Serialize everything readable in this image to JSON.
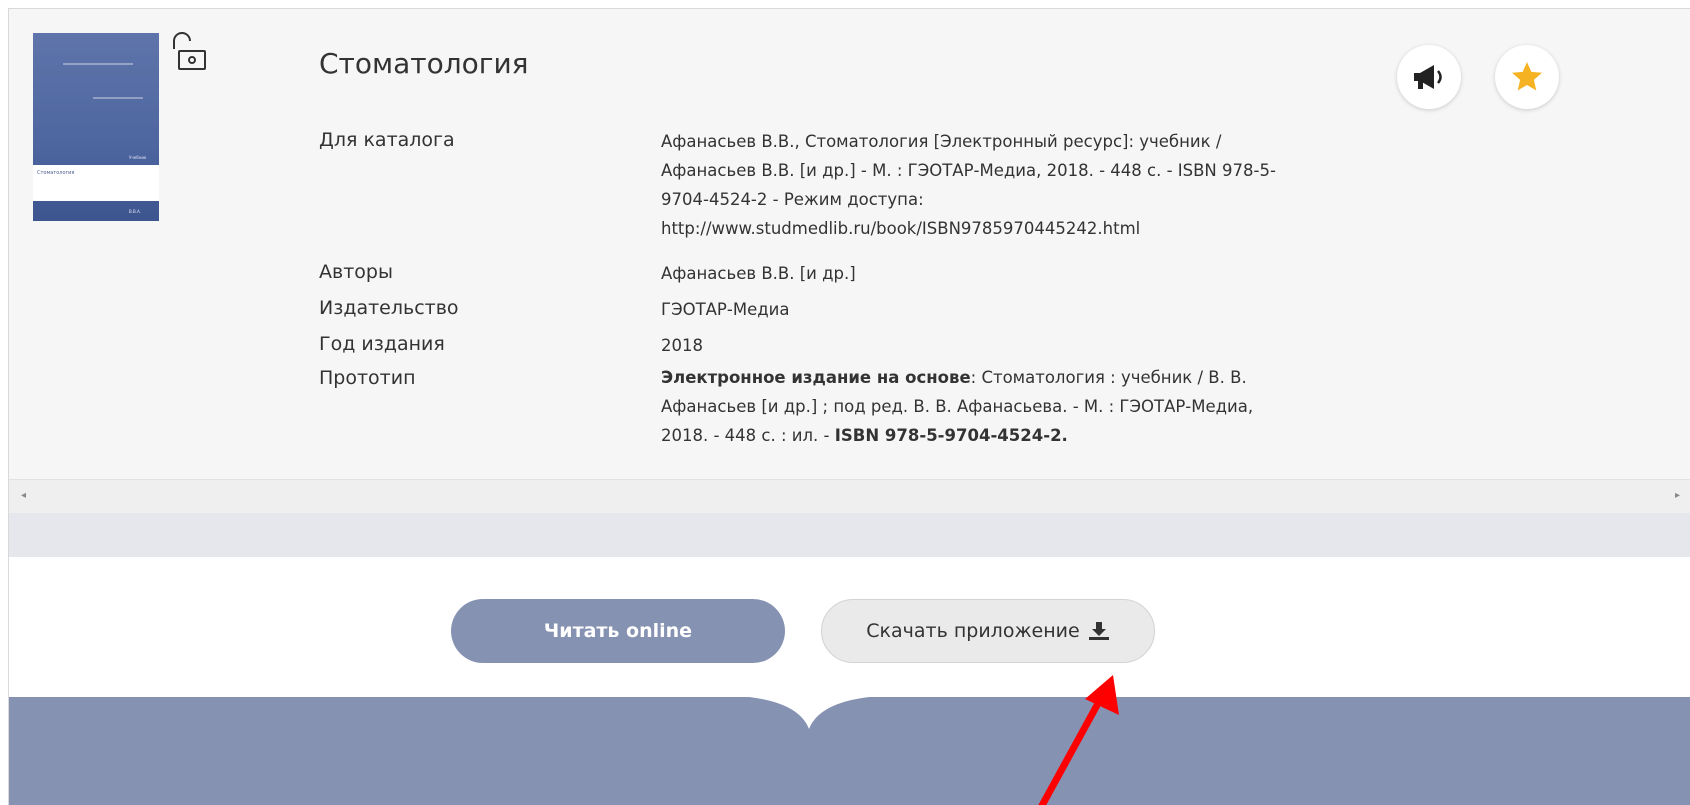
{
  "book": {
    "title": "Стоматология",
    "fields": [
      {
        "label": "Для каталога",
        "value": "Афанасьев В.В., Стоматология [Электронный ресурс]: учебник / Афанасьев В.В. [и др.] - М. : ГЭОТАР-Медиа, 2018. - 448 с. - ISBN 978-5-9704-4524-2 - Режим доступа: http://www.studmedlib.ru/book/ISBN9785970445242.html"
      },
      {
        "label": "Авторы",
        "value": "Афанасьев В.В. [и др.]"
      },
      {
        "label": "Издательство",
        "value": "ГЭОТАР-Медиа"
      },
      {
        "label": "Год издания",
        "value": "2018"
      },
      {
        "label": "Прототип",
        "value_bold_prefix": "Электронное издание на основе",
        "value": ": Стоматология : учебник / В. В. Афанасьев [и др.] ; под ред. В. В. Афанасьева. - М. : ГЭОТАР-Медиа, 2018. - 448 с. : ил. - ",
        "value_bold_suffix": "ISBN 978-5-9704-4524-2."
      }
    ]
  },
  "cover": {
    "text_title": "Стоматология",
    "text_top": "Учебник",
    "text_bottom": "В.В.А."
  },
  "actions": {
    "read_online_label": "Читать online",
    "download_app_label": "Скачать приложение"
  },
  "icons": {
    "lock": "unlocked-lock-icon",
    "announce": "megaphone-icon",
    "favorite": "star-icon",
    "download": "download-icon"
  },
  "colors": {
    "accent": "#8692b2",
    "star": "#f5b324",
    "annotation_arrow": "#ff0000"
  }
}
